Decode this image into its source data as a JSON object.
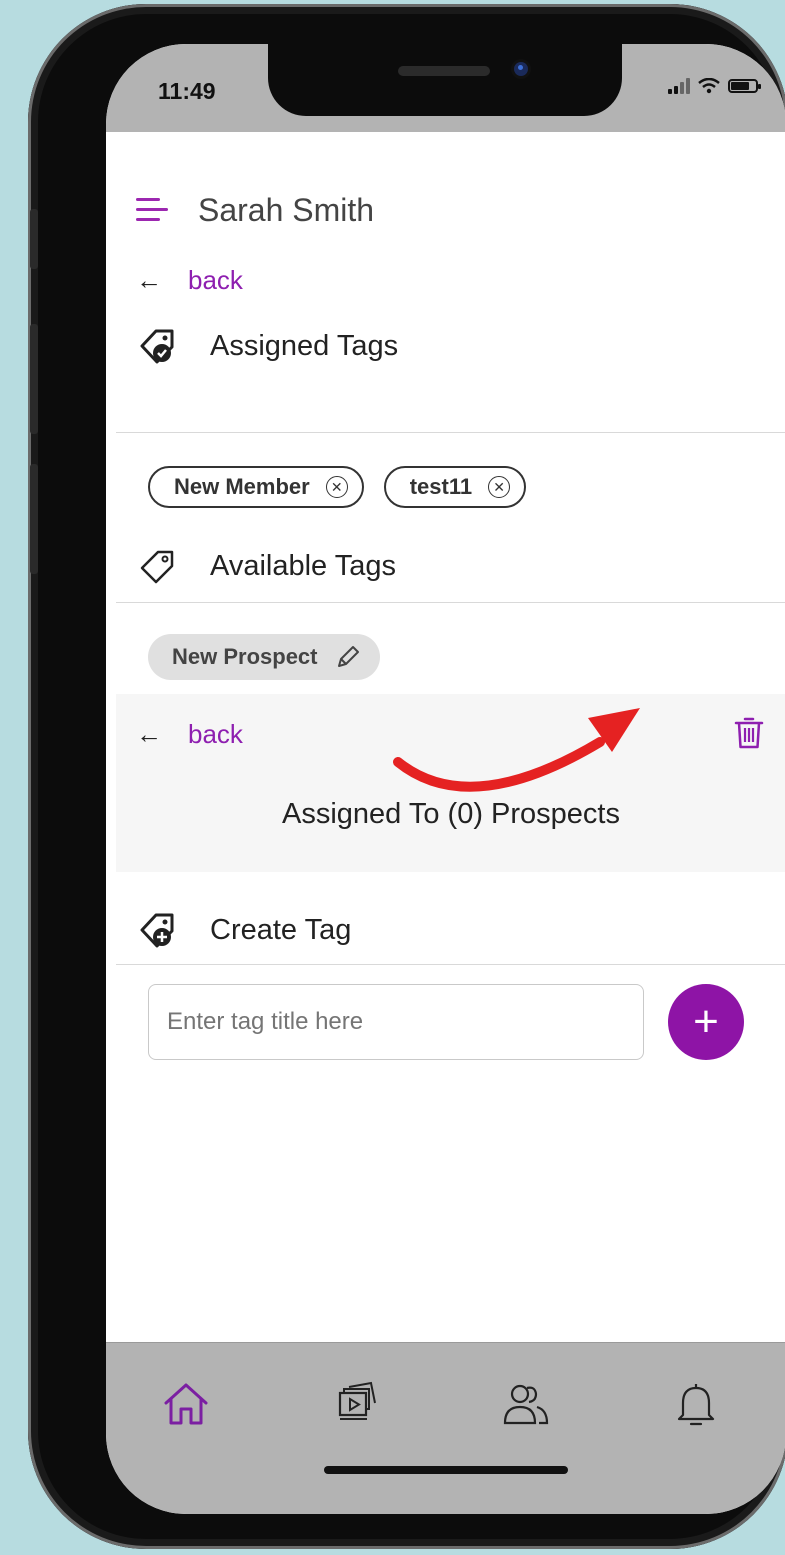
{
  "status_bar": {
    "time": "11:49"
  },
  "header": {
    "user_name": "Sarah Smith"
  },
  "nav_back": {
    "label": "back"
  },
  "assigned_tags": {
    "title": "Assigned Tags",
    "chips": [
      {
        "label": "New Member"
      },
      {
        "label": "test11"
      }
    ]
  },
  "available_tags": {
    "title": "Available Tags",
    "chips": [
      {
        "label": "New Prospect"
      }
    ]
  },
  "tag_detail": {
    "back_label": "back",
    "assigned_count_text": "Assigned To (0) Prospects"
  },
  "create_tag": {
    "title": "Create Tag",
    "input_placeholder": "Enter tag title here",
    "add_button": "+"
  },
  "bottom_nav": {
    "items": [
      {
        "icon": "home-icon",
        "active": true
      },
      {
        "icon": "media-icon",
        "active": false
      },
      {
        "icon": "people-icon",
        "active": false
      },
      {
        "icon": "bell-icon",
        "active": false
      }
    ]
  },
  "colors": {
    "accent": "#8e1fb0",
    "add_button": "#8e14a6",
    "annotation_arrow": "#e52222",
    "background": "#b7dce0"
  }
}
